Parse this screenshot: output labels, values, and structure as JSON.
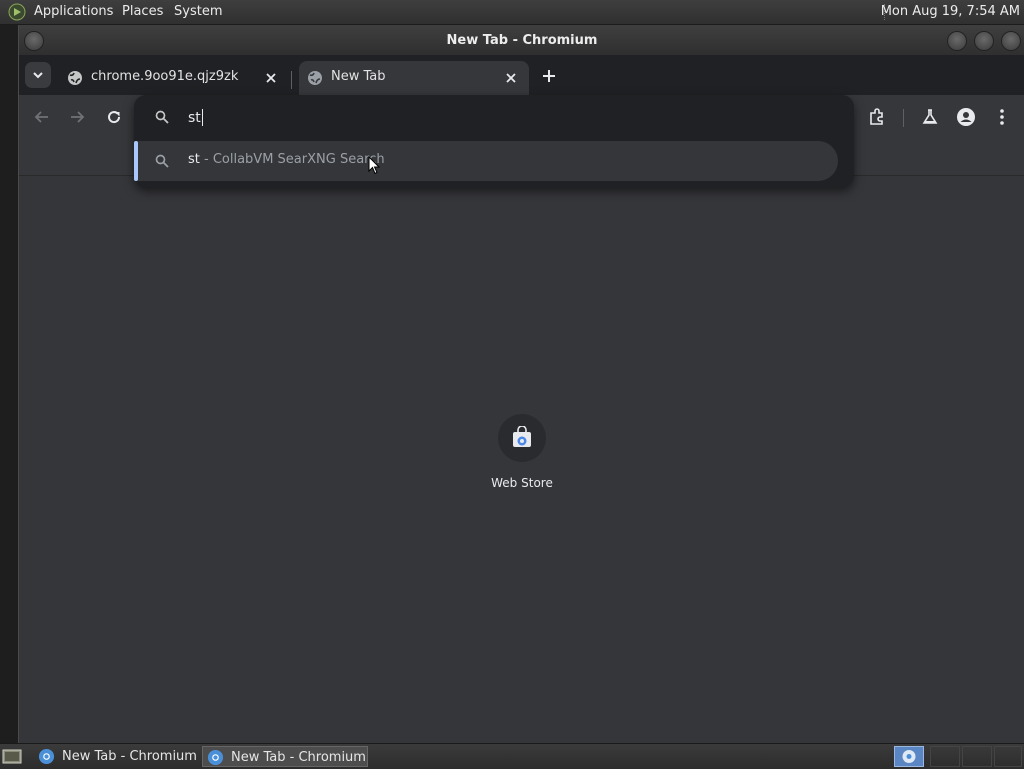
{
  "top_panel": {
    "menus": [
      "Applications",
      "Places",
      "System"
    ],
    "clock": "Mon Aug 19,  7:54 AM"
  },
  "window": {
    "title": "New Tab - Chromium"
  },
  "tabs": [
    {
      "label": "chrome.9oo91e.qjz9zk",
      "active": false
    },
    {
      "label": "New Tab",
      "active": true
    }
  ],
  "omnibox": {
    "value": "st",
    "suggestion": {
      "match": "st",
      "description": " - CollabVM SearXNG Search"
    }
  },
  "shortcuts": [
    {
      "label": "Web Store",
      "icon": "web-store-icon"
    }
  ],
  "taskbar": {
    "tasks": [
      {
        "label": "New Tab - Chromium",
        "active": false
      },
      {
        "label": "New Tab - Chromium",
        "active": true
      }
    ]
  },
  "colors": {
    "accent": "#a8c7fa",
    "ntp_background": "#35363a",
    "tab_strip": "#202124",
    "workspace_active": "#5a86c4"
  }
}
